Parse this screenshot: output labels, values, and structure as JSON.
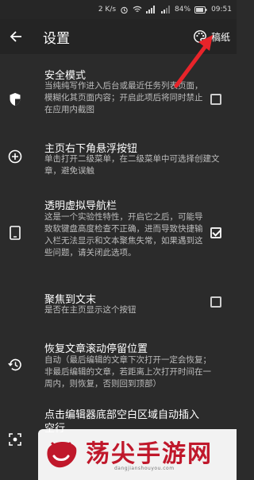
{
  "status_bar": {
    "network_speed": "2 K/s",
    "battery": "84%",
    "time": "09:51"
  },
  "app_bar": {
    "title": "设置",
    "theme_label": "稿纸"
  },
  "settings": [
    {
      "title": "安全模式",
      "description": "当纯纯写作进入后台或最近任务列表页面，模糊化其页面内容；开启此项后将同时禁止在应用内截图",
      "icon": "shield-icon",
      "has_checkbox": true,
      "checked": false
    },
    {
      "title": "主页右下角悬浮按钮",
      "description": "单击打开二级菜单，在二级菜单中可选择创建文章，避免误触",
      "icon": "add-circle-icon",
      "has_checkbox": false,
      "checked": false
    },
    {
      "title": "透明虚拟导航栏",
      "description": "这是一个实验性特性，开启它之后，可能导致软键盘高度检查不正确，进而导致快捷输入栏无法显示和文本聚焦失常，如果遇到这些问题，请关闭此选项。",
      "icon": "tablet-icon",
      "has_checkbox": true,
      "checked": true
    },
    {
      "title": "聚焦到文末",
      "description": "是否在主页显示这个按钮",
      "icon": "",
      "has_checkbox": true,
      "checked": false
    },
    {
      "title": "恢复文章滚动停留位置",
      "description": "自动（最后编辑的文章下次打开一定会恢复；非最后编辑的文章，若距离上次打开时间在一周内，则恢复，否则回到顶部）",
      "icon": "history-icon",
      "has_checkbox": false,
      "checked": false
    },
    {
      "title": "点击编辑器底部空白区域自动插入空行",
      "description": "",
      "icon": "focus-icon",
      "has_checkbox": false,
      "checked": false
    }
  ],
  "watermark": {
    "text": "荡尖手游网",
    "url": "dangjianshouyou.com"
  },
  "colors": {
    "background": "#2b2b2b",
    "app_bar": "#242424",
    "annotation_arrow": "#e8242a",
    "watermark_red": "#c0182b"
  }
}
